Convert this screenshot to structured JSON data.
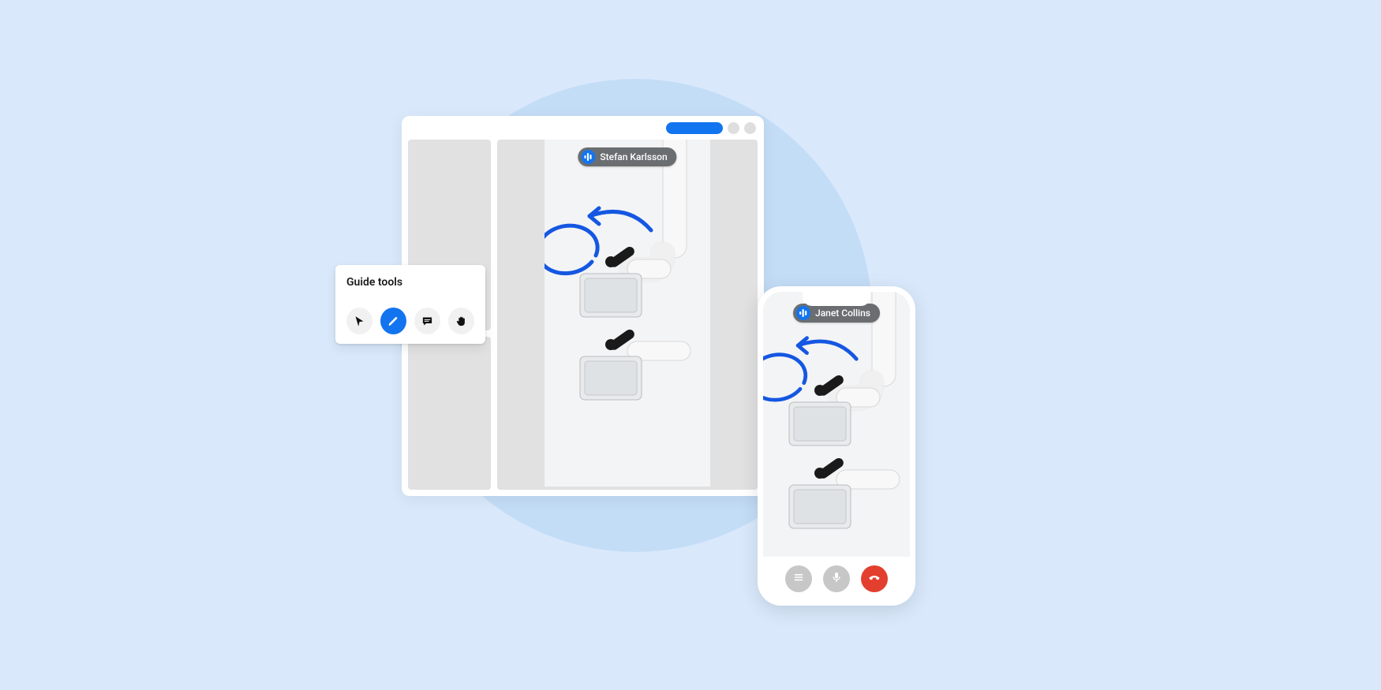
{
  "guide_panel": {
    "title": "Guide tools",
    "tools": [
      {
        "name": "pointer",
        "icon": "cursor-icon",
        "active": false
      },
      {
        "name": "draw",
        "icon": "pencil-icon",
        "active": true
      },
      {
        "name": "chat",
        "icon": "chat-icon",
        "active": false
      },
      {
        "name": "hand",
        "icon": "hand-icon",
        "active": false
      }
    ]
  },
  "desktop": {
    "speaker_name": "Stefan Karlsson",
    "speaking": true,
    "annotation_color": "#1457e2"
  },
  "mobile": {
    "speaker_name": "Janet Collins",
    "speaking": true,
    "call_actions": [
      {
        "name": "menu",
        "icon": "menu-icon"
      },
      {
        "name": "mute",
        "icon": "mic-icon"
      },
      {
        "name": "hangup",
        "icon": "hangup-icon"
      }
    ]
  },
  "colors": {
    "accent": "#1374ef",
    "hangup": "#e33f2e",
    "annotation": "#1457e2"
  }
}
